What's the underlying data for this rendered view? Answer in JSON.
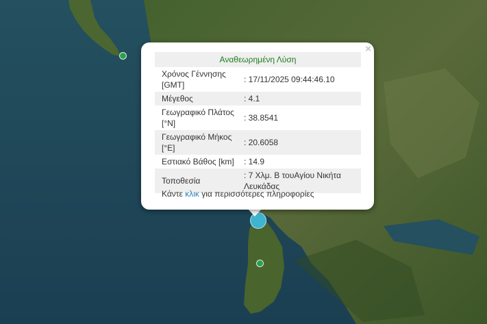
{
  "popup": {
    "title": "Αναθεωρημένη Λύση",
    "close": "×",
    "rows": [
      {
        "label": "Χρόνος Γέννησης [GMT]",
        "value": ": 17/11/2025 09:44:46.10"
      },
      {
        "label": "Μέγεθος",
        "value": ": 4.1"
      },
      {
        "label": "Γεωγραφικό Πλάτος [°N]",
        "value": ": 38.8541"
      },
      {
        "label": "Γεωγραφικό Μήκος [°E]",
        "value": ": 20.6058"
      },
      {
        "label": "Εστιακό Βάθος [km]",
        "value": ": 14.9"
      },
      {
        "label": "Τοποθεσία",
        "value": ": 7 Χλμ. Β τουΑγίου Νικήτα Λευκάδας"
      }
    ],
    "footer_before": "Κάντε",
    "footer_link": "κλικ",
    "footer_after": "για περισσότερες πληροφορίες"
  },
  "colors": {
    "sea": "#1f4a5e",
    "land": "#3c5a2a",
    "marker_recent": "#3fb4cf",
    "marker_other": "#2e9e52",
    "title_green": "#1d7b1d"
  },
  "icons": [
    "close-icon",
    "earthquake-marker",
    "earthquake-marker-small"
  ]
}
